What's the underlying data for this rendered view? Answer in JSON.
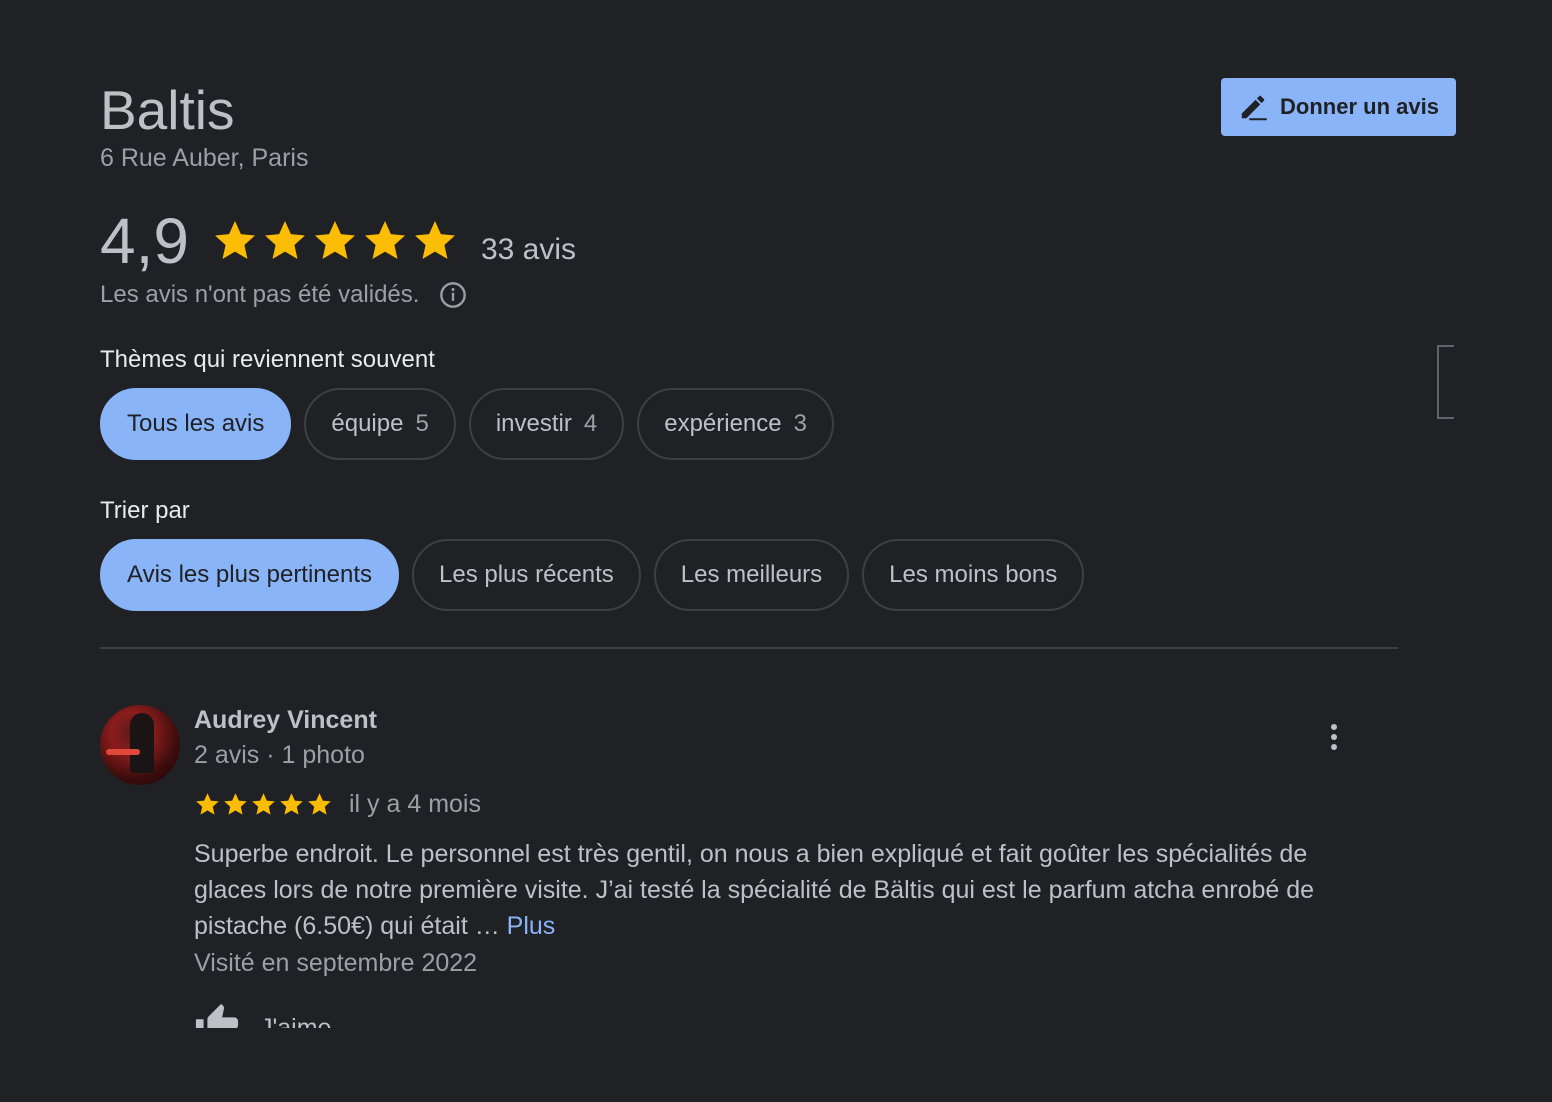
{
  "place": {
    "name": "Baltis",
    "address": "6 Rue Auber, Paris"
  },
  "actions": {
    "write_review_label": "Donner un avis",
    "write_review_icon": "pencil-icon"
  },
  "summary": {
    "rating": "4,9",
    "stars": 5,
    "review_count": "33 avis",
    "unverified_notice": "Les avis n'ont pas été validés."
  },
  "themes": {
    "label": "Thèmes qui reviennent souvent",
    "chips": [
      {
        "label": "Tous les avis",
        "count": "",
        "selected": true
      },
      {
        "label": "équipe",
        "count": "5",
        "selected": false
      },
      {
        "label": "investir",
        "count": "4",
        "selected": false
      },
      {
        "label": "expérience",
        "count": "3",
        "selected": false
      }
    ]
  },
  "sort": {
    "label": "Trier par",
    "chips": [
      {
        "label": "Avis les plus pertinents",
        "selected": true
      },
      {
        "label": "Les plus récents",
        "selected": false
      },
      {
        "label": "Les meilleurs",
        "selected": false
      },
      {
        "label": "Les moins bons",
        "selected": false
      }
    ]
  },
  "review": {
    "author": "Audrey Vincent",
    "meta": "2 avis · 1 photo",
    "stars": 5,
    "time": "il y a 4 mois",
    "text": "Superbe endroit. Le personnel est très gentil, on nous a bien expliqué et fait goûter les spécialités de glaces lors de notre première visite. J’ai testé la spécialité de Bältis qui est le parfum atcha enrobé de pistache (6.50€) qui était … ",
    "more_label": "Plus",
    "visited": "Visité en septembre 2022",
    "like_label": "J'aime"
  },
  "colors": {
    "background": "#202124",
    "accent": "#8ab4f8",
    "star": "#fbbc04"
  }
}
